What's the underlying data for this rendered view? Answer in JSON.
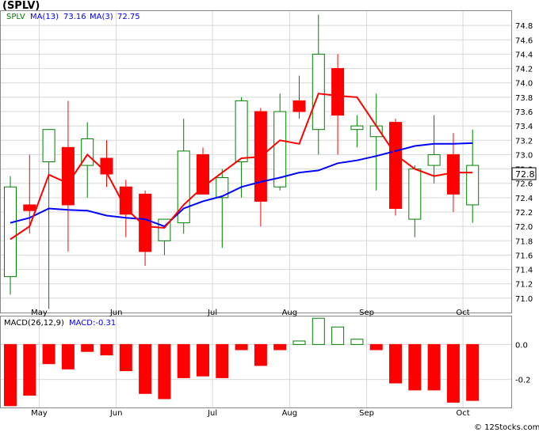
{
  "title": "(SPLV)",
  "watermark": "© 12Stocks.com",
  "colors": {
    "up": "#008000",
    "down": "#ff0000",
    "ma13": "#0000ff",
    "ma3": "#ff0000",
    "grid": "#d8d8d8",
    "axis_label": "#000000",
    "legend_ticker": "#008000",
    "legend_blue": "#0000ff"
  },
  "legend": {
    "ticker": "SPLV",
    "ma13_label": "MA(13)",
    "ma13_value": "73.16",
    "ma3_label": "MA(3)",
    "ma3_value": "72.75"
  },
  "last_price_tag": "72.8",
  "macd_legend": {
    "label": "MACD(26,12,9)",
    "value_label": "MACD:-0.31"
  },
  "chart_data": [
    {
      "type": "candlestick",
      "title": "(SPLV)",
      "ylim": [
        70.8,
        75.0
      ],
      "yticks": [
        "71.0",
        "71.2",
        "71.4",
        "71.6",
        "71.8",
        "72.0",
        "72.2",
        "72.4",
        "72.6",
        "72.8",
        "73.0",
        "73.2",
        "73.4",
        "73.6",
        "73.8",
        "74.0",
        "74.2",
        "74.4",
        "74.6",
        "74.8"
      ],
      "xticks": [
        {
          "label": "May",
          "at": 1.5
        },
        {
          "label": "Jun",
          "at": 5.5
        },
        {
          "label": "Jul",
          "at": 10.5
        },
        {
          "label": "Aug",
          "at": 14.5
        },
        {
          "label": "Sep",
          "at": 18.5
        },
        {
          "label": "Oct",
          "at": 23.5
        }
      ],
      "candles": [
        {
          "o": 71.3,
          "h": 72.7,
          "l": 71.05,
          "c": 72.55
        },
        {
          "o": 72.3,
          "h": 73.0,
          "l": 71.9,
          "c": 72.22
        },
        {
          "o": 72.9,
          "h": 73.3,
          "l": 70.85,
          "c": 73.35
        },
        {
          "o": 73.1,
          "h": 73.75,
          "l": 71.65,
          "c": 72.3
        },
        {
          "o": 72.85,
          "h": 73.45,
          "l": 72.4,
          "c": 73.22
        },
        {
          "o": 72.95,
          "h": 73.2,
          "l": 72.55,
          "c": 72.73
        },
        {
          "o": 72.55,
          "h": 72.65,
          "l": 71.85,
          "c": 72.17
        },
        {
          "o": 72.45,
          "h": 72.5,
          "l": 71.45,
          "c": 71.65
        },
        {
          "o": 71.8,
          "h": 72.1,
          "l": 71.6,
          "c": 72.1
        },
        {
          "o": 72.05,
          "h": 73.5,
          "l": 71.9,
          "c": 73.05
        },
        {
          "o": 73.0,
          "h": 73.1,
          "l": 72.45,
          "c": 72.45
        },
        {
          "o": 72.4,
          "h": 72.8,
          "l": 71.7,
          "c": 72.68
        },
        {
          "o": 72.9,
          "h": 73.8,
          "l": 72.4,
          "c": 73.75
        },
        {
          "o": 73.6,
          "h": 73.65,
          "l": 72.0,
          "c": 72.35
        },
        {
          "o": 72.55,
          "h": 73.85,
          "l": 72.5,
          "c": 73.6
        },
        {
          "o": 73.75,
          "h": 74.1,
          "l": 73.5,
          "c": 73.6
        },
        {
          "o": 73.35,
          "h": 74.95,
          "l": 73.0,
          "c": 74.4
        },
        {
          "o": 74.2,
          "h": 74.4,
          "l": 73.0,
          "c": 73.55
        },
        {
          "o": 73.35,
          "h": 73.55,
          "l": 73.1,
          "c": 73.4
        },
        {
          "o": 73.25,
          "h": 73.85,
          "l": 72.5,
          "c": 73.4
        },
        {
          "o": 73.45,
          "h": 73.5,
          "l": 72.15,
          "c": 72.25
        },
        {
          "o": 72.1,
          "h": 72.85,
          "l": 71.85,
          "c": 72.8
        },
        {
          "o": 72.85,
          "h": 73.55,
          "l": 72.6,
          "c": 73.0
        },
        {
          "o": 73.0,
          "h": 73.3,
          "l": 72.2,
          "c": 72.45
        },
        {
          "o": 72.3,
          "h": 73.35,
          "l": 72.05,
          "c": 72.85
        }
      ],
      "series": [
        {
          "name": "MA(13)",
          "color": "#0000ff",
          "values": [
            72.05,
            72.12,
            72.25,
            72.23,
            72.22,
            72.15,
            72.12,
            72.1,
            72.0,
            72.25,
            72.35,
            72.42,
            72.55,
            72.62,
            72.68,
            72.75,
            72.78,
            72.88,
            72.92,
            72.98,
            73.05,
            73.12,
            73.15,
            73.15,
            73.16
          ]
        },
        {
          "name": "MA(3)",
          "color": "#ff0000",
          "values": [
            71.82,
            72.0,
            72.72,
            72.6,
            73.0,
            72.75,
            72.25,
            72.0,
            71.98,
            72.3,
            72.55,
            72.75,
            72.95,
            72.97,
            73.2,
            73.15,
            73.85,
            73.82,
            73.8,
            73.4,
            73.0,
            72.8,
            72.7,
            72.75,
            72.75
          ]
        }
      ]
    },
    {
      "type": "bar",
      "title": "MACD(26,12,9)",
      "ylim": [
        -0.36,
        0.16
      ],
      "yticks": [
        {
          "v": 0.0,
          "label": "0.0"
        },
        {
          "v": -0.2,
          "label": "-0.2"
        }
      ],
      "values": [
        -0.35,
        -0.29,
        -0.11,
        -0.14,
        -0.04,
        -0.06,
        -0.15,
        -0.28,
        -0.31,
        -0.19,
        -0.18,
        -0.19,
        -0.03,
        -0.12,
        -0.03,
        0.02,
        0.15,
        0.1,
        0.03,
        -0.03,
        -0.22,
        -0.26,
        -0.26,
        -0.33,
        -0.32
      ]
    }
  ]
}
